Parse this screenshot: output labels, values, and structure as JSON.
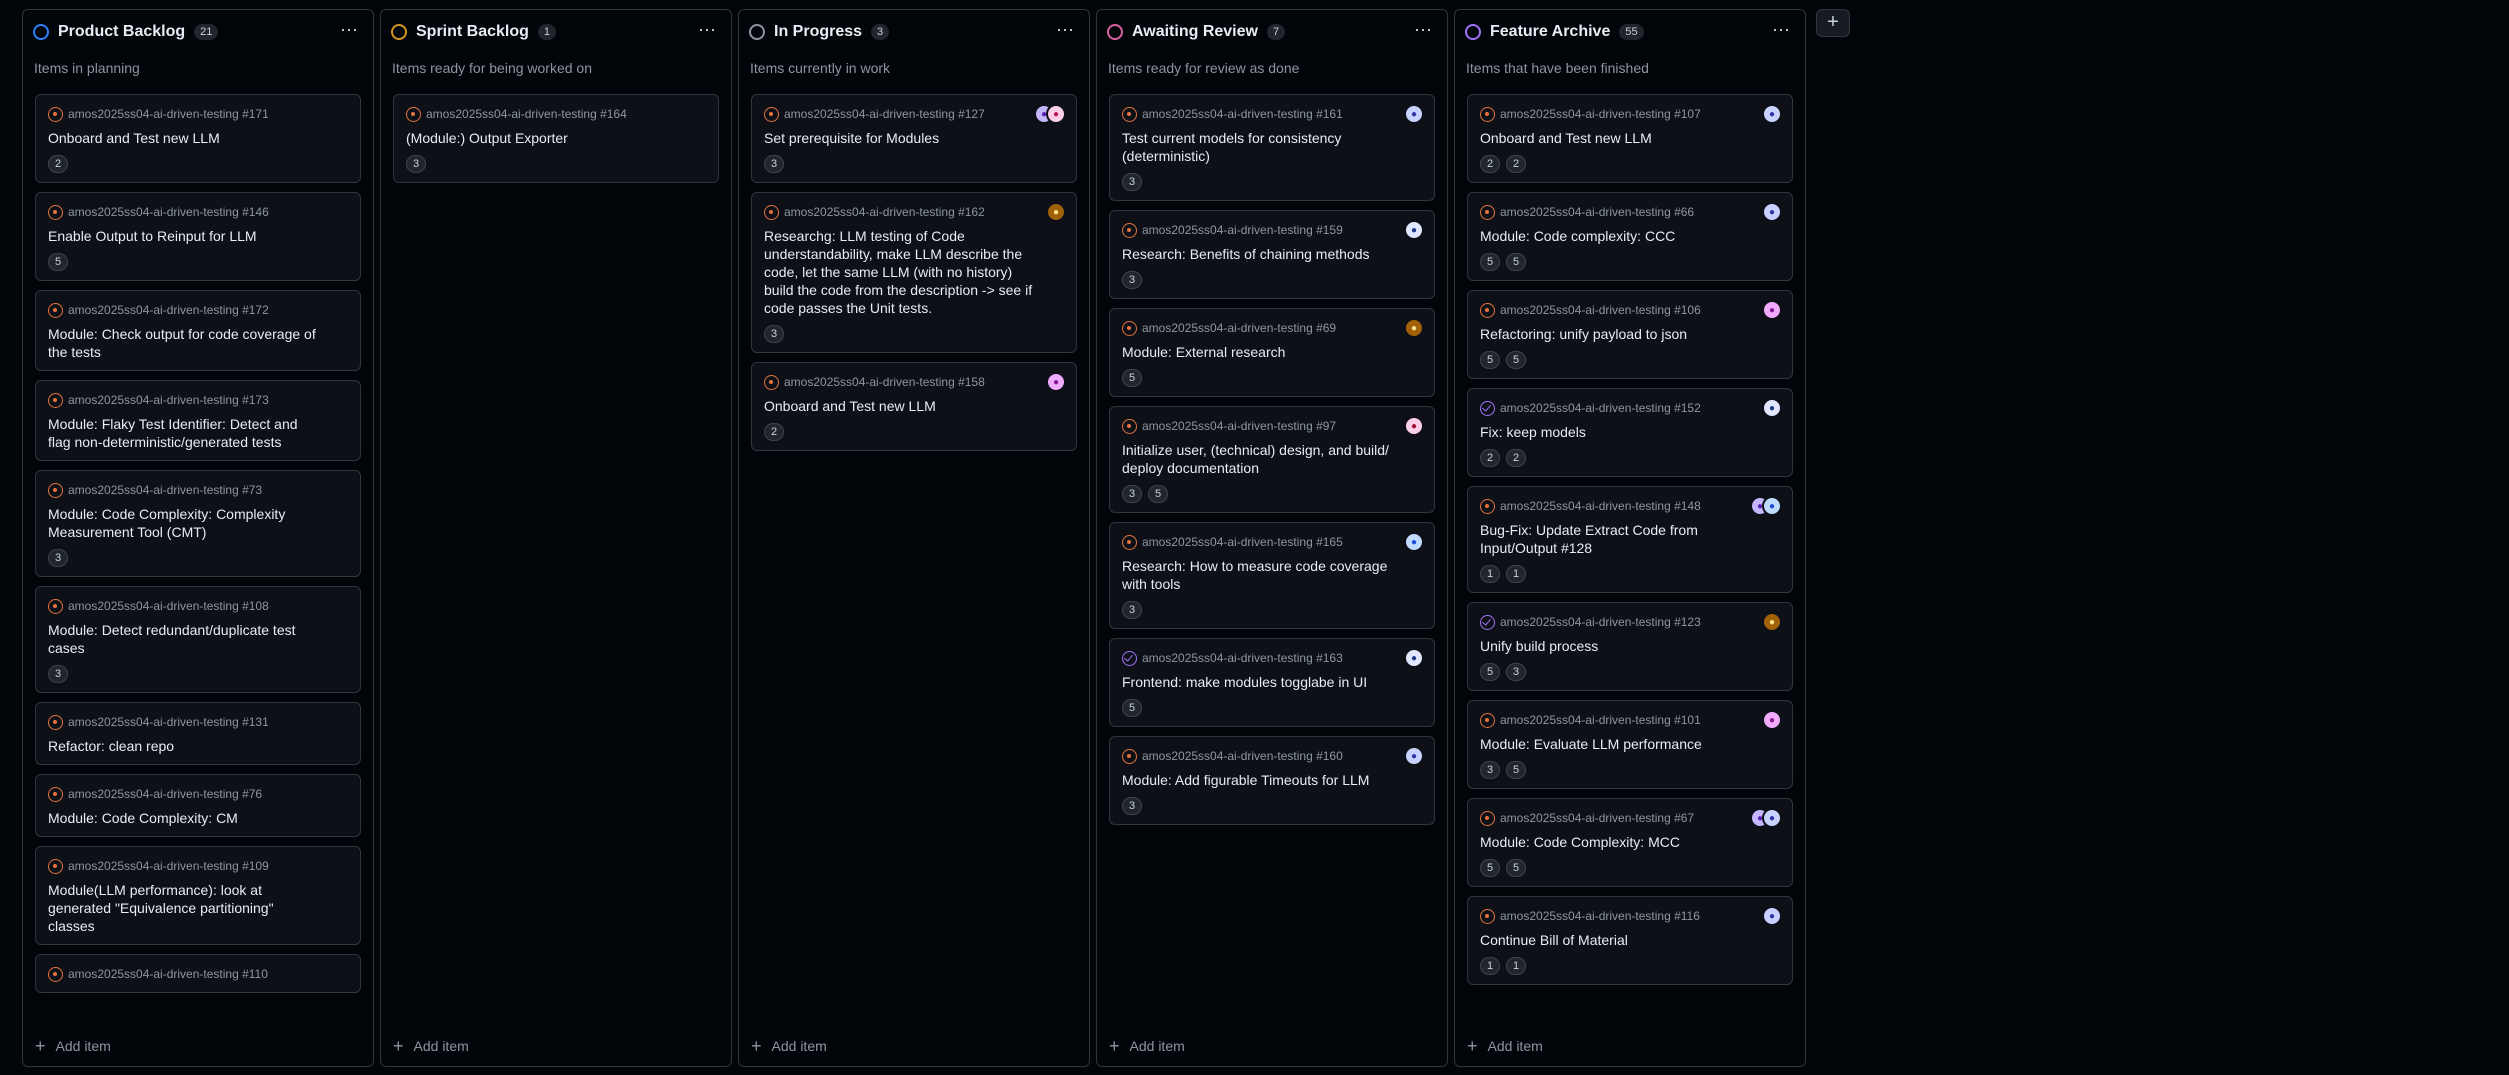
{
  "board": {
    "add_column_label": "+",
    "add_item_label": "Add item",
    "menu_label": "⋯",
    "columns": [
      {
        "title": "Product Backlog",
        "count": "21",
        "color": "#2f81f7",
        "description": "Items in planning",
        "cards": [
          {
            "ref": "amos2025ss04-ai-driven-testing #171",
            "title": "Onboard and Test new LLM",
            "chips": [
              "2"
            ],
            "state": "open",
            "avatars": []
          },
          {
            "ref": "amos2025ss04-ai-driven-testing #146",
            "title": "Enable Output to Reinput for LLM",
            "chips": [
              "5"
            ],
            "state": "open",
            "avatars": []
          },
          {
            "ref": "amos2025ss04-ai-driven-testing #172",
            "title": "Module: Check output for code coverage of the tests",
            "chips": [],
            "state": "open",
            "avatars": []
          },
          {
            "ref": "amos2025ss04-ai-driven-testing #173",
            "title": "Module: Flaky Test Identifier: Detect and flag non-deterministic/generated tests",
            "chips": [],
            "state": "open",
            "avatars": []
          },
          {
            "ref": "amos2025ss04-ai-driven-testing #73",
            "title": "Module: Code Complexity: Complexity Measurement Tool (CMT)",
            "chips": [
              "3"
            ],
            "state": "open",
            "avatars": []
          },
          {
            "ref": "amos2025ss04-ai-driven-testing #108",
            "title": "Module: Detect redundant/duplicate test cases",
            "chips": [
              "3"
            ],
            "state": "open",
            "avatars": []
          },
          {
            "ref": "amos2025ss04-ai-driven-testing #131",
            "title": "Refactor: clean repo",
            "chips": [],
            "state": "open",
            "avatars": []
          },
          {
            "ref": "amos2025ss04-ai-driven-testing #76",
            "title": "Module: Code Complexity: CM",
            "chips": [],
            "state": "open",
            "avatars": []
          },
          {
            "ref": "amos2025ss04-ai-driven-testing #109",
            "title": "Module(LLM performance): look at generated \"Equivalence partitioning\" classes",
            "chips": [],
            "state": "open",
            "avatars": []
          },
          {
            "ref": "amos2025ss04-ai-driven-testing #110",
            "title": "",
            "chips": [],
            "state": "open",
            "avatars": []
          }
        ]
      },
      {
        "title": "Sprint Backlog",
        "count": "1",
        "color": "#d29922",
        "description": "Items ready for being worked on",
        "cards": [
          {
            "ref": "amos2025ss04-ai-driven-testing #164",
            "title": "(Module:) Output Exporter",
            "chips": [
              "3"
            ],
            "state": "open",
            "avatars": []
          }
        ]
      },
      {
        "title": "In Progress",
        "count": "3",
        "color": "#8d96a0",
        "description": "Items currently in work",
        "cards": [
          {
            "ref": "amos2025ss04-ai-driven-testing #127",
            "title": "Set prerequisite for Modules",
            "chips": [
              "3"
            ],
            "state": "open",
            "avatars": [
              {
                "bg": "#c4b5fd",
                "fg": "#5b21b6"
              },
              {
                "bg": "#fbcfe8",
                "fg": "#be185d"
              }
            ]
          },
          {
            "ref": "amos2025ss04-ai-driven-testing #162",
            "title": "Researchg: LLM testing of Code understandability, make LLM describe the code, let the same LLM (with no history) build the code from the description -> see if code passes the Unit tests.",
            "chips": [
              "3"
            ],
            "state": "open",
            "avatars": [
              {
                "bg": "#a16207",
                "fg": "#fde68a"
              }
            ]
          },
          {
            "ref": "amos2025ss04-ai-driven-testing #158",
            "title": "Onboard and Test new LLM",
            "chips": [
              "2"
            ],
            "state": "open",
            "avatars": [
              {
                "bg": "#f0abfc",
                "fg": "#86198f"
              }
            ]
          }
        ]
      },
      {
        "title": "Awaiting Review",
        "count": "7",
        "color": "#db61a2",
        "description": "Items ready for review as done",
        "cards": [
          {
            "ref": "amos2025ss04-ai-driven-testing #161",
            "title": "Test current models for consistency (deterministic)",
            "chips": [
              "3"
            ],
            "state": "open",
            "avatars": [
              {
                "bg": "#c7d2fe",
                "fg": "#3730a3"
              }
            ]
          },
          {
            "ref": "amos2025ss04-ai-driven-testing #159",
            "title": "Research: Benefits of chaining methods",
            "chips": [
              "3"
            ],
            "state": "open",
            "avatars": [
              {
                "bg": "#e0e7ff",
                "fg": "#1e3a8a"
              }
            ]
          },
          {
            "ref": "amos2025ss04-ai-driven-testing #69",
            "title": "Module: External research",
            "chips": [
              "5"
            ],
            "state": "open",
            "avatars": [
              {
                "bg": "#a16207",
                "fg": "#fde68a"
              }
            ]
          },
          {
            "ref": "amos2025ss04-ai-driven-testing #97",
            "title": "Initialize user, (technical) design, and build/ deploy documentation",
            "chips": [
              "3",
              "5"
            ],
            "state": "open",
            "avatars": [
              {
                "bg": "#fbcfe8",
                "fg": "#9f1239"
              }
            ]
          },
          {
            "ref": "amos2025ss04-ai-driven-testing #165",
            "title": "Research: How to measure code coverage with tools",
            "chips": [
              "3"
            ],
            "state": "open",
            "avatars": [
              {
                "bg": "#bfdbfe",
                "fg": "#1d4ed8"
              }
            ]
          },
          {
            "ref": "amos2025ss04-ai-driven-testing #163",
            "title": "Frontend: make modules togglabe in UI",
            "chips": [
              "5"
            ],
            "state": "closed",
            "avatars": [
              {
                "bg": "#e0e7ff",
                "fg": "#1e3a8a"
              }
            ]
          },
          {
            "ref": "amos2025ss04-ai-driven-testing #160",
            "title": "Module: Add figurable Timeouts for LLM",
            "chips": [
              "3"
            ],
            "state": "open",
            "avatars": [
              {
                "bg": "#c7d2fe",
                "fg": "#3730a3"
              }
            ]
          }
        ]
      },
      {
        "title": "Feature Archive",
        "count": "55",
        "color": "#a371f7",
        "description": "Items that have been finished",
        "cards": [
          {
            "ref": "amos2025ss04-ai-driven-testing #107",
            "title": "Onboard and Test new LLM",
            "chips": [
              "2",
              "2"
            ],
            "state": "open",
            "avatars": [
              {
                "bg": "#c7d2fe",
                "fg": "#3730a3"
              }
            ]
          },
          {
            "ref": "amos2025ss04-ai-driven-testing #66",
            "title": "Module: Code complexity: CCC",
            "chips": [
              "5",
              "5"
            ],
            "state": "open",
            "avatars": [
              {
                "bg": "#c7d2fe",
                "fg": "#3730a3"
              }
            ]
          },
          {
            "ref": "amos2025ss04-ai-driven-testing #106",
            "title": "Refactoring: unify payload to json",
            "chips": [
              "5",
              "5"
            ],
            "state": "open",
            "avatars": [
              {
                "bg": "#f0abfc",
                "fg": "#86198f"
              }
            ]
          },
          {
            "ref": "amos2025ss04-ai-driven-testing #152",
            "title": "Fix: keep models",
            "chips": [
              "2",
              "2"
            ],
            "state": "closed",
            "avatars": [
              {
                "bg": "#e0e7ff",
                "fg": "#1e3a8a"
              }
            ]
          },
          {
            "ref": "amos2025ss04-ai-driven-testing #148",
            "title": "Bug-Fix: Update Extract Code from Input/Output #128",
            "chips": [
              "1",
              "1"
            ],
            "state": "open",
            "avatars": [
              {
                "bg": "#c4b5fd",
                "fg": "#5b21b6"
              },
              {
                "bg": "#bfdbfe",
                "fg": "#1d4ed8"
              }
            ]
          },
          {
            "ref": "amos2025ss04-ai-driven-testing #123",
            "title": "Unify build process",
            "chips": [
              "5",
              "3"
            ],
            "state": "closed",
            "avatars": [
              {
                "bg": "#a16207",
                "fg": "#fde68a"
              }
            ]
          },
          {
            "ref": "amos2025ss04-ai-driven-testing #101",
            "title": "Module: Evaluate LLM performance",
            "chips": [
              "3",
              "5"
            ],
            "state": "open",
            "avatars": [
              {
                "bg": "#f0abfc",
                "fg": "#86198f"
              }
            ]
          },
          {
            "ref": "amos2025ss04-ai-driven-testing #67",
            "title": "Module: Code Complexity: MCC",
            "chips": [
              "5",
              "5"
            ],
            "state": "open",
            "avatars": [
              {
                "bg": "#c4b5fd",
                "fg": "#5b21b6"
              },
              {
                "bg": "#c7d2fe",
                "fg": "#3730a3"
              }
            ]
          },
          {
            "ref": "amos2025ss04-ai-driven-testing #116",
            "title": "Continue Bill of Material",
            "chips": [
              "1",
              "1"
            ],
            "state": "open",
            "avatars": [
              {
                "bg": "#c7d2fe",
                "fg": "#3730a3"
              }
            ]
          }
        ]
      }
    ]
  }
}
